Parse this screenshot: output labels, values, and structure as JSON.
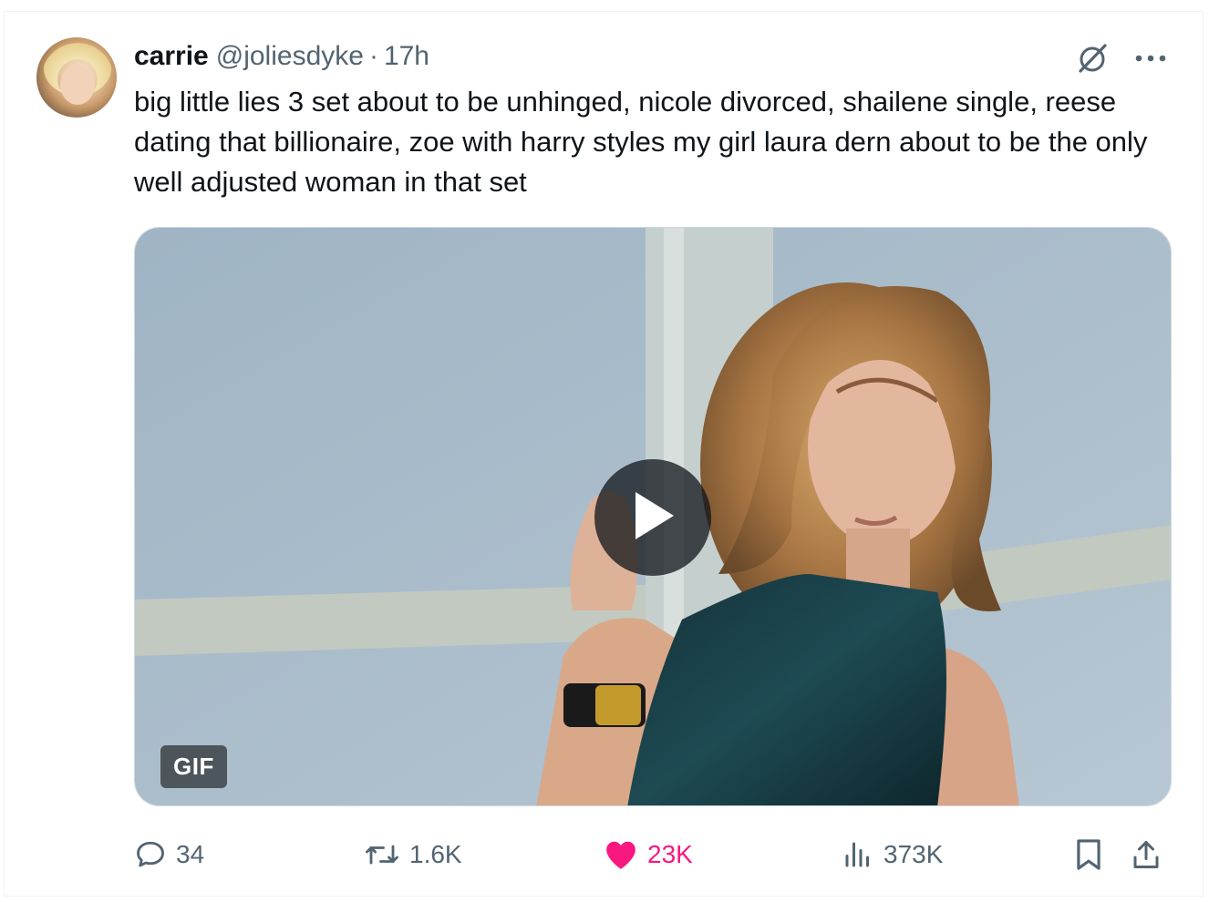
{
  "tweet": {
    "author_name": "carrie",
    "handle": "@joliesdyke",
    "separator": "·",
    "time": "17h",
    "text": "big little lies 3 set about to be unhinged, nicole divorced, shailene single, reese dating that billionaire, zoe with harry styles my girl laura dern about to be the only well adjusted woman in that set",
    "media": {
      "badge": "GIF"
    },
    "stats": {
      "replies": "34",
      "reposts": "1.6K",
      "likes": "23K",
      "views": "373K"
    }
  },
  "icons": {
    "header": [
      "grok-icon",
      "more-icon"
    ],
    "actions": [
      "reply-icon",
      "repost-icon",
      "like-icon",
      "views-icon",
      "bookmark-icon",
      "share-icon"
    ]
  },
  "colors": {
    "like_accent": "#f91880",
    "secondary_text": "#536471",
    "primary_text": "#0f1419"
  }
}
